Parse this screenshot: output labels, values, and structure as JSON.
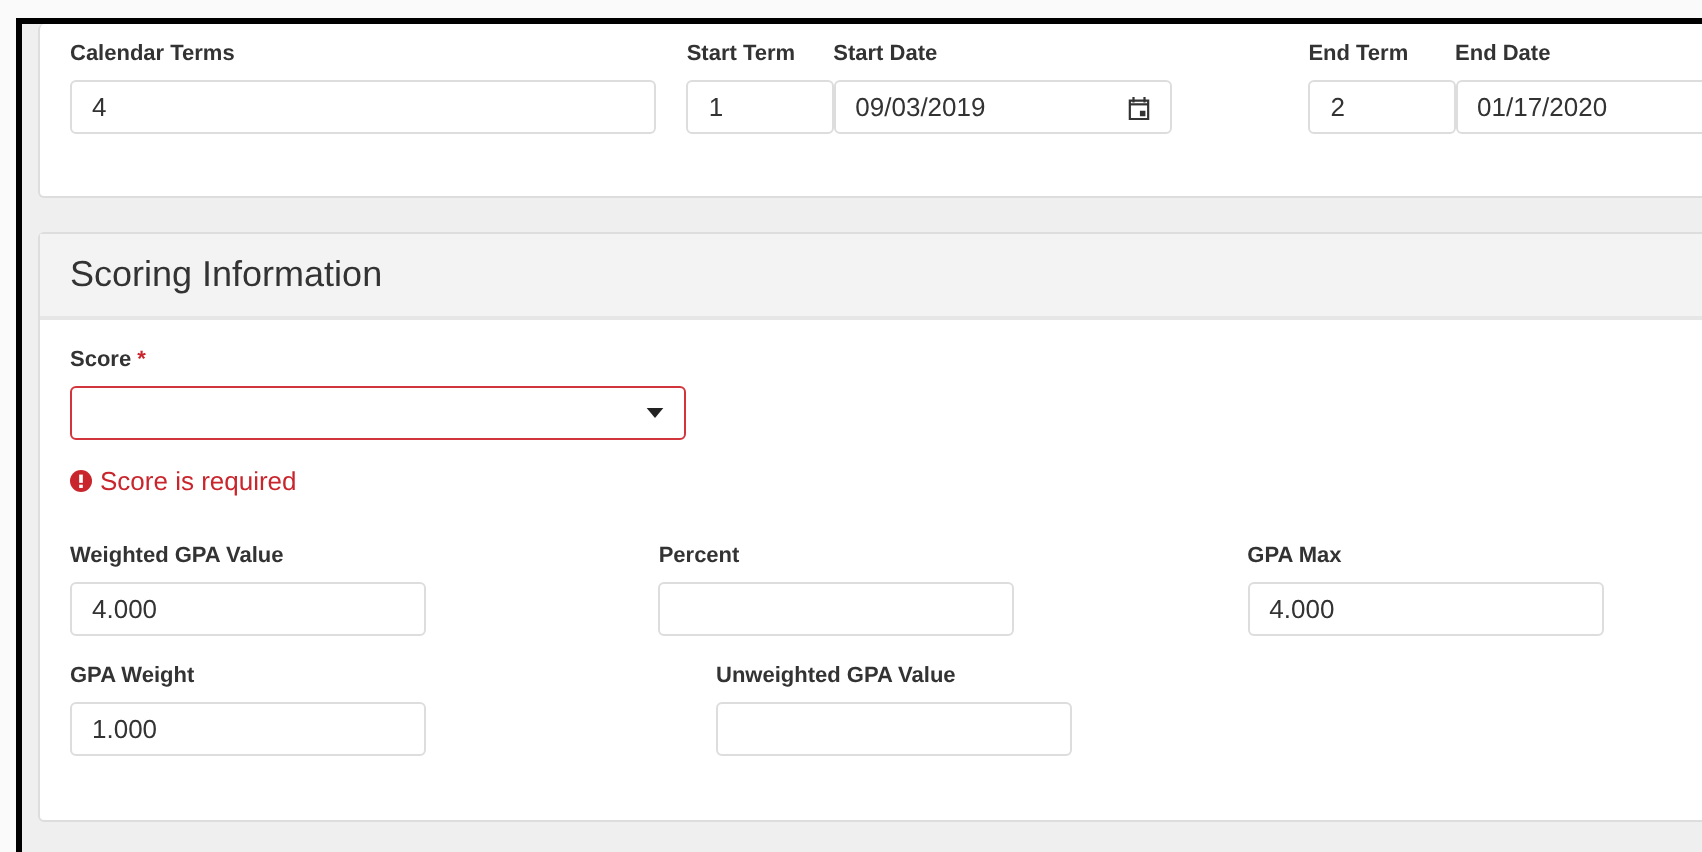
{
  "term_card": {
    "fields": [
      {
        "label": "Calendar Terms",
        "value": "4",
        "kind": "text"
      },
      {
        "label": "Start Term",
        "value": "1",
        "kind": "text"
      },
      {
        "label": "Start Date",
        "value": "09/03/2019",
        "kind": "date"
      },
      {
        "label": "End Term",
        "value": "2",
        "kind": "text"
      },
      {
        "label": "End Date",
        "value": "01/17/2020",
        "kind": "text"
      }
    ]
  },
  "scoring": {
    "title": "Scoring Information",
    "score": {
      "label": "Score",
      "required_mark": "*",
      "invalid": true,
      "error": "Score is required"
    },
    "rows": [
      [
        {
          "label": "Weighted GPA Value",
          "value": "4.000"
        },
        {
          "label": "Percent"
        },
        {
          "label": "GPA Max",
          "value": "4.000"
        }
      ],
      [
        {
          "label": "GPA Weight",
          "value": "1.000"
        },
        {
          "label": "Unweighted GPA Value"
        }
      ]
    ]
  }
}
